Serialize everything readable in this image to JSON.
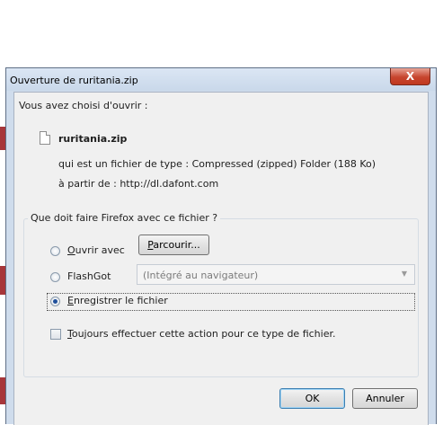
{
  "dialog": {
    "title": "Ouverture de ruritania.zip",
    "close_label": "X",
    "intro": "Vous avez choisi d'ouvrir :",
    "file_name": "ruritania.zip",
    "type_prefix": "qui est un fichier de type : ",
    "type_value": "Compressed (zipped) Folder (188 Ko)",
    "source_prefix": "à partir de : ",
    "source_value": "http://dl.dafont.com",
    "group_title": "Que doit faire Firefox avec ce fichier ?",
    "open_with": {
      "accel": "O",
      "rest": "uvrir avec",
      "selected": false
    },
    "browse_button": {
      "accel": "P",
      "rest": "arcourir..."
    },
    "flashgot": {
      "label": "FlashGot",
      "selected": false
    },
    "flashgot_select": {
      "value": "(Intégré au navigateur)",
      "arrow_icon": "chevron-down-icon"
    },
    "save_file": {
      "accel": "E",
      "rest": "nregistrer le fichier",
      "selected": true
    },
    "always_checkbox": {
      "accel": "T",
      "rest": "oujours effectuer cette action pour ce type de fichier.",
      "checked": false
    },
    "ok_label": "OK",
    "cancel_label": "Annuler"
  }
}
